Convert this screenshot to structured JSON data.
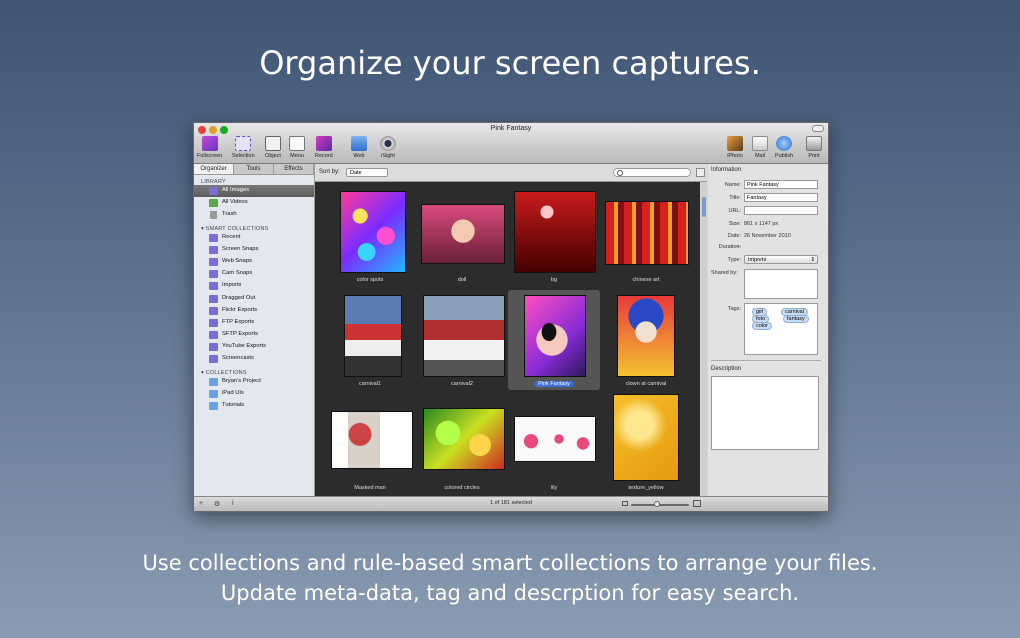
{
  "headline": "Organize your screen captures.",
  "caption": {
    "line1": "Use collections and rule-based smart collections to arrange your files.",
    "line2": "Update meta-data, tag and descrption for easy search."
  },
  "window": {
    "title": "Pink Fantasy",
    "toolbar_left": [
      "Fullscreen",
      "Selection",
      "Object",
      "Menu",
      "Record",
      "Web",
      "iSight"
    ],
    "toolbar_right": [
      "iPhoto",
      "Mail",
      "Publish",
      "Print"
    ]
  },
  "sidebar": {
    "tabs": [
      "Organizer",
      "Tools",
      "Effects"
    ],
    "library_heading": "LIBRARY",
    "library": [
      "All Images",
      "All Videos",
      "Trash"
    ],
    "smart_heading": "SMART COLLECTIONS",
    "smart": [
      "Recent",
      "Screen Snaps",
      "Web Snaps",
      "Cam Snaps",
      "Imports",
      "Dragged Out",
      "Flickr Exports",
      "FTP Exports",
      "SFTP Exports",
      "YouTube Exports",
      "Screencasts"
    ],
    "collections_heading": "COLLECTIONS",
    "collections": [
      "Bryan's Project",
      "iPad UIs",
      "Tutorials"
    ]
  },
  "browser": {
    "sort_label": "Sort by:",
    "sort_value": "Date",
    "thumbnails": [
      "color spots",
      "doll",
      "bg",
      "chinese art",
      "carnival1",
      "carnival2",
      "Pink Fantasy",
      "clown at carnival",
      "Masked man",
      "colored circles",
      "lily",
      "texture_yellow"
    ]
  },
  "info": {
    "heading": "Information",
    "name_label": "Name:",
    "name": "Pink Fantasy",
    "title_label": "Title:",
    "title": "Fantasy",
    "url_label": "URL:",
    "url": "",
    "size_label": "Size:",
    "size": "861 x 1147 px",
    "date_label": "Date:",
    "date": "26 November 2010",
    "duration_label": "Duration:",
    "duration": "--",
    "type_label": "Type:",
    "type": "Imports",
    "shared_label": "Shared by:",
    "tags_label": "Tags:",
    "tags": [
      "girl",
      "carnival",
      "foto",
      "fantasy",
      "color"
    ],
    "description_label": "Description"
  },
  "status": {
    "selection": "1 of 181 selected"
  },
  "colors": {
    "background_top": "#3f5473",
    "background_bottom": "#8a9bb1",
    "selection_blue": "#3d6fd4"
  }
}
